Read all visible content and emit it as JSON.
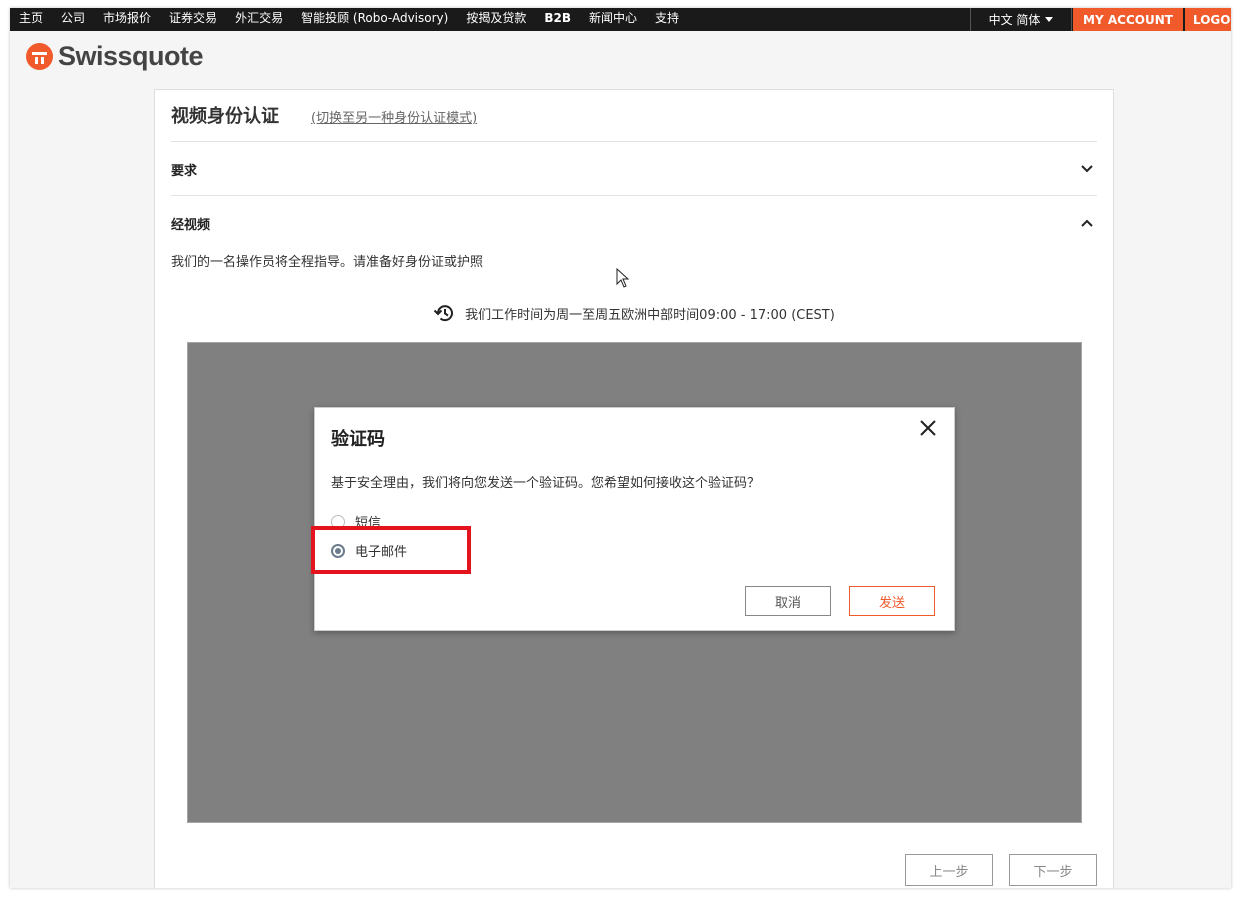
{
  "nav": {
    "items": [
      "主页",
      "公司",
      "市场报价",
      "证券交易",
      "外汇交易",
      "智能投顾 (Robo-Advisory)",
      "按揭及贷款",
      "B2B",
      "新闻中心",
      "支持"
    ],
    "language": "中文 简体",
    "my_account": "MY ACCOUNT",
    "logout": "LOGO"
  },
  "brand": {
    "name": "Swissquote",
    "color": "#f15a2b"
  },
  "page": {
    "title": "视频身份认证",
    "switch_mode": "(切换至另一种身份认证模式)",
    "requirements_label": "要求",
    "video_label": "经视频",
    "description": "我们的一名操作员将全程指导。请准备好身份证或护照",
    "hours": "我们工作时间为周一至周五欧洲中部时间09:00 - 17:00 (CEST)",
    "prev_button": "上一步",
    "next_button": "下一步"
  },
  "modal": {
    "title": "验证码",
    "text": "基于安全理由，我们将向您发送一个验证码。您希望如何接收这个验证码？",
    "option_sms": "短信",
    "option_email": "电子邮件",
    "selected": "电子邮件",
    "cancel": "取消",
    "send": "发送"
  }
}
